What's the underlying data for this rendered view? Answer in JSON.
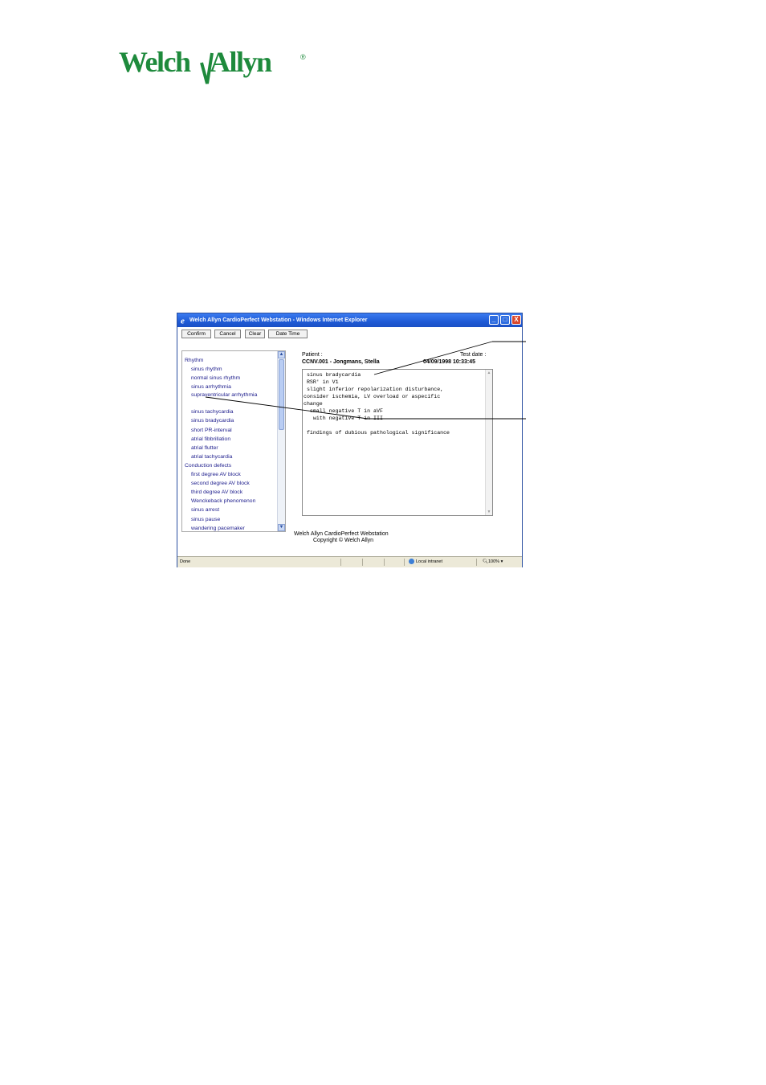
{
  "logo": {
    "text": "WelchAllyn",
    "registered": "®",
    "color": "#1e8a3c"
  },
  "window": {
    "title": "Welch Allyn CardioPerfect Webstation - Windows Internet Explorer",
    "buttons": {
      "minimize": "_",
      "maximize": "□",
      "close": "X"
    }
  },
  "toolbar": {
    "confirm": "Confirm",
    "cancel": "Cancel",
    "clear": "Clear",
    "datetime": "Date Time"
  },
  "list": {
    "items": [
      {
        "label": "Rhythm",
        "type": "category"
      },
      {
        "label": "sinus rhythm",
        "type": "item"
      },
      {
        "label": "normal sinus rhythm",
        "type": "item"
      },
      {
        "label": "sinus arrhythmia",
        "type": "item"
      },
      {
        "label": "supraventricular arrhythmia",
        "type": "item"
      },
      {
        "label": "sinus tachycardia",
        "type": "item"
      },
      {
        "label": "sinus bradycardia",
        "type": "item"
      },
      {
        "label": "short PR-interval",
        "type": "item"
      },
      {
        "label": "atrial fibbrillation",
        "type": "item"
      },
      {
        "label": "atrial flutter",
        "type": "item"
      },
      {
        "label": "atrial tachycardia",
        "type": "item"
      },
      {
        "label": "Conduction defects",
        "type": "category"
      },
      {
        "label": "first degree AV block",
        "type": "item"
      },
      {
        "label": "second degree AV block",
        "type": "item"
      },
      {
        "label": "third degree AV block",
        "type": "item"
      },
      {
        "label": "Wenckeback phenomenon",
        "type": "item"
      },
      {
        "label": "sinus arrest",
        "type": "item"
      },
      {
        "label": "sinus pause",
        "type": "item"
      },
      {
        "label": "wandering pacemaker",
        "type": "item"
      }
    ]
  },
  "patient": {
    "label": "Patient :",
    "value": "CCNV.001 - Jongmans, Stella",
    "test_date_label": "Test date :",
    "test_date_value": "04/09/1998 10:33:45"
  },
  "report": {
    "text": " sinus bradycardia\n RSR' in V1\n slight inferior repolarization disturbance,\nconsider ischemia, LV overload or aspecific\nchange\n  small negative T in aVF\n   with negative T in III\n\n findings of dubious pathological significance"
  },
  "footer": {
    "line1": "Welch Allyn CardioPerfect Webstation",
    "line2": "Copyright © Welch Allyn"
  },
  "statusbar": {
    "done": "Done",
    "zone": "Local intranet",
    "zoom": "100%"
  }
}
